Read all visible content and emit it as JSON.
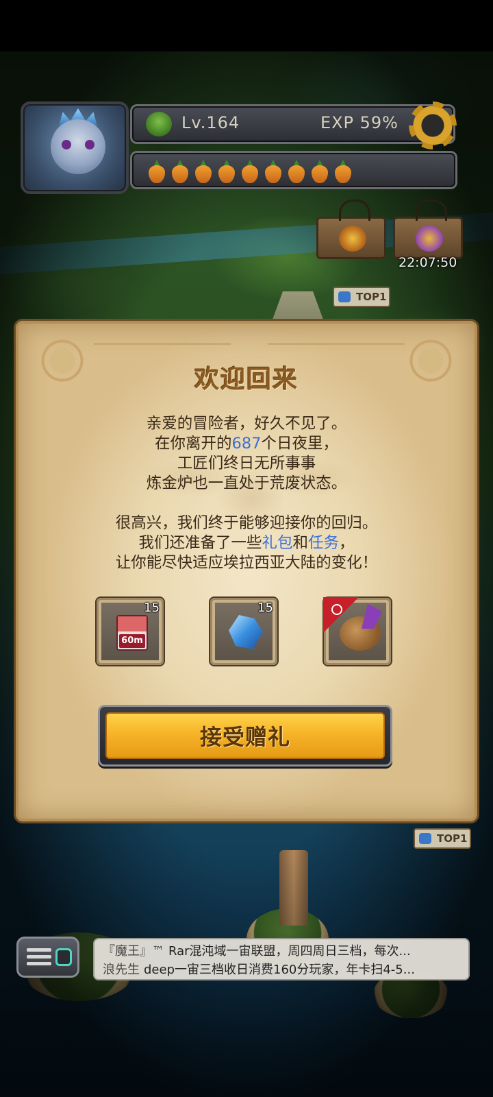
{
  "hud": {
    "level": "Lv.164",
    "exp": "EXP 59%",
    "carrot_count": 9,
    "timer": "22:07:50",
    "top_badge": "TOP1"
  },
  "dialog": {
    "title": "欢迎回来",
    "para1": {
      "line1": "亲爱的冒险者，好久不见了。",
      "line2_pre": "在你离开的",
      "line2_days": "687",
      "line2_post": "个日夜里，",
      "line3": "工匠们终日无所事事",
      "line4": "炼金炉也一直处于荒废状态。"
    },
    "para2": {
      "line1": "很高兴，我们终于能够迎接你的回归。",
      "line2_pre": "我们还准备了一些",
      "line2_gift": "礼包",
      "line2_mid": "和",
      "line2_task": "任务",
      "line2_post": "，",
      "line3": "让你能尽快适应埃拉西亚大陆的变化！"
    },
    "rewards": [
      {
        "icon": "time-ticket-icon",
        "label": "60m",
        "count": "15"
      },
      {
        "icon": "blue-crystal-icon",
        "count": "15"
      },
      {
        "icon": "pet-dragon-icon",
        "count": ""
      }
    ],
    "accept_label": "接受赠礼"
  },
  "chat": {
    "messages": [
      {
        "name": "『魔王』™",
        "text": "Rar混沌域一宙联盟，周四周日三档，每次..."
      },
      {
        "name": "浪先生",
        "text": "deep一宙三档收日消费160分玩家，年卡扫4-5..."
      }
    ]
  },
  "colors": {
    "highlight": "#3a6fd8",
    "button": "#f6b428",
    "parchment": "#ead8b0"
  }
}
